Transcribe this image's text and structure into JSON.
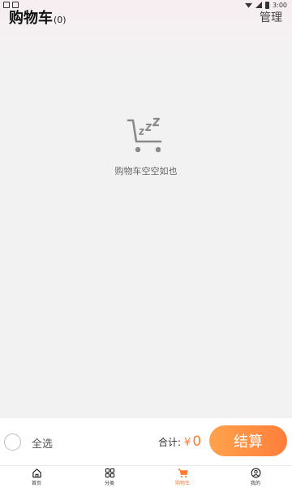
{
  "status_bar": {
    "time": "3:00"
  },
  "header": {
    "title": "购物车",
    "count": "(0)",
    "manage_label": "管理"
  },
  "empty_state": {
    "icon": "empty-cart-sleeping-icon",
    "text": "购物车空空如也"
  },
  "checkout": {
    "select_all_label": "全选",
    "total_label": "合计:",
    "currency": "¥",
    "total_value": "0",
    "checkout_label": "结算"
  },
  "tabs": [
    {
      "label": "首页",
      "icon": "home-icon",
      "active": false
    },
    {
      "label": "分类",
      "icon": "grid-icon",
      "active": false
    },
    {
      "label": "购物车",
      "icon": "cart-icon",
      "active": true
    },
    {
      "label": "我的",
      "icon": "user-icon",
      "active": false
    }
  ],
  "colors": {
    "accent": "#ff7a33",
    "accent_light": "#ffa24d",
    "background": "#f2f2f2"
  }
}
